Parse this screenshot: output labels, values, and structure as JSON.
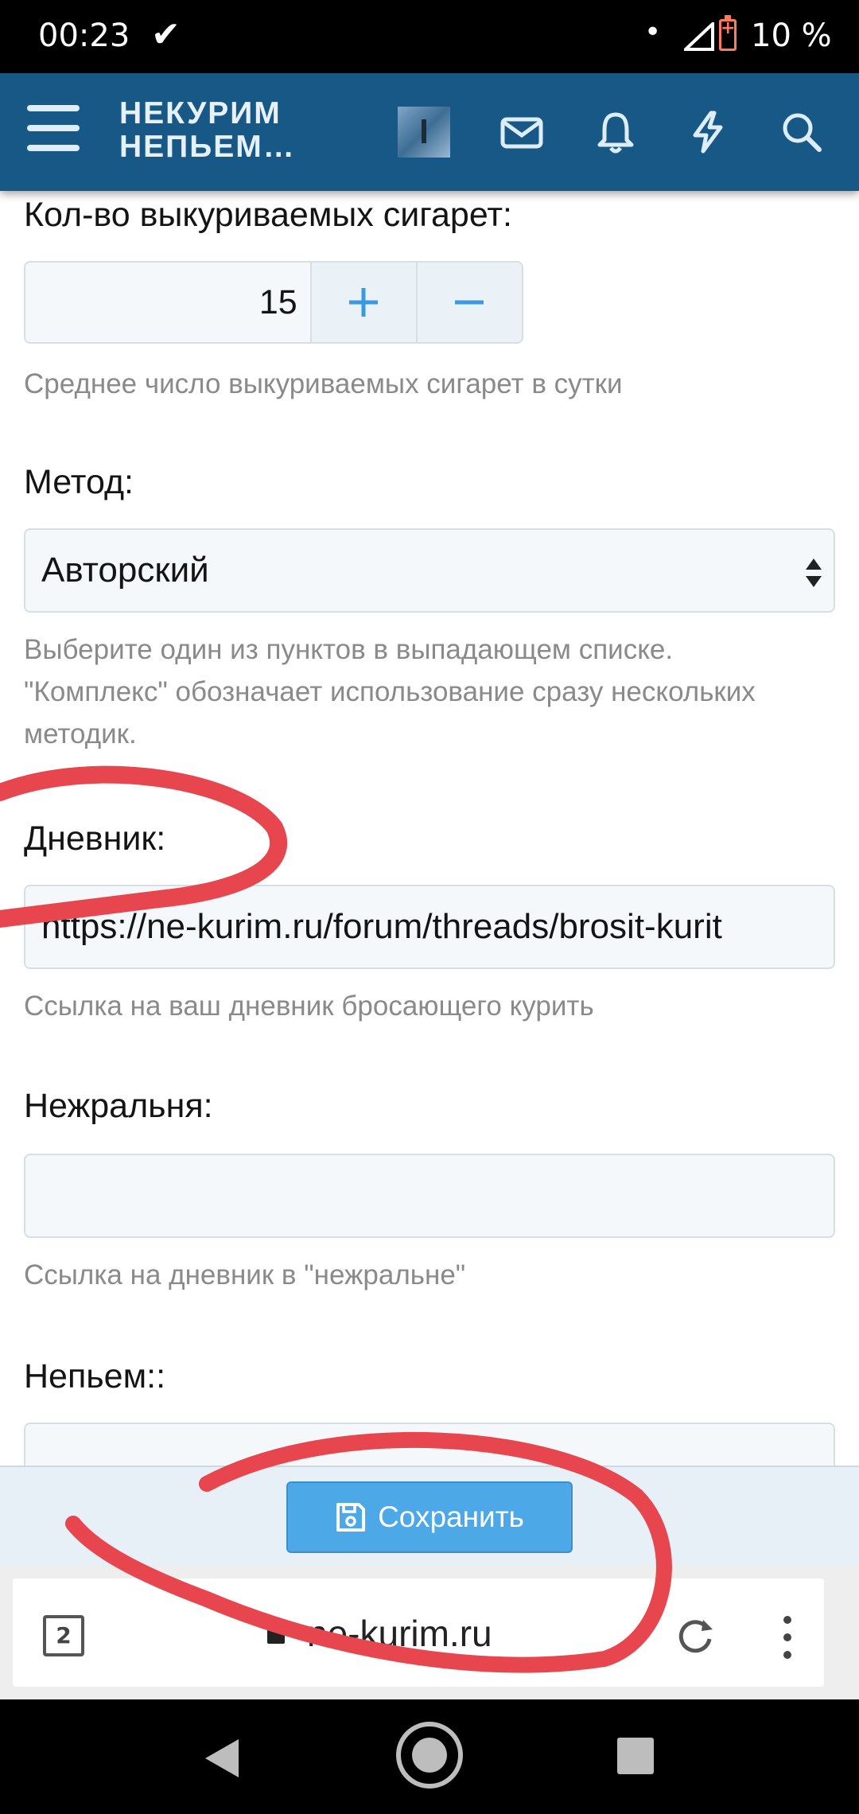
{
  "status_bar": {
    "time": "00:23",
    "battery": "10 %"
  },
  "header": {
    "logo_line1": "НЕКУРИМ",
    "logo_line2": "НЕПЬЕМ…",
    "icons": [
      "menu-icon",
      "avatar",
      "mail-icon",
      "bell-icon",
      "lightning-icon",
      "search-icon"
    ]
  },
  "form": {
    "cigarettes": {
      "label": "Кол-во выкуриваемых сигарет:",
      "value": "15",
      "plus": "+",
      "minus": "−",
      "hint": "Среднее число выкуриваемых сигарет в сутки"
    },
    "method": {
      "label": "Метод:",
      "value": "Авторский",
      "hint": "Выберите один из пунктов в выпадающем списке. \"Комплекс\" обозначает использование сразу нескольких методик."
    },
    "diary": {
      "label": "Дневник:",
      "value": "https://ne-kurim.ru/forum/threads/brosit-kurit",
      "hint": "Ссылка на ваш дневник бросающего курить"
    },
    "nezhralnya": {
      "label": "Нежральня:",
      "value": "",
      "hint": "Ссылка на дневник в \"нежральне\""
    },
    "nepyem": {
      "label": "Непьем::",
      "value": ""
    }
  },
  "save_button": {
    "label": "Сохранить"
  },
  "browser": {
    "tab_count": "2",
    "url": "ne-kurim.ru"
  },
  "colors": {
    "header_bg": "#185886",
    "accent": "#4da8e8",
    "annotation": "#e8464e"
  }
}
